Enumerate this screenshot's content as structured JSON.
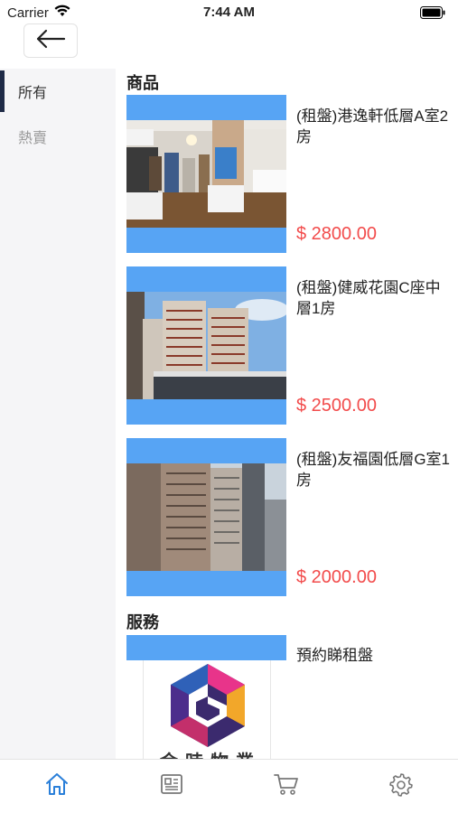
{
  "status_bar": {
    "carrier": "Carrier",
    "time": "7:44 AM"
  },
  "sidebar": {
    "items": [
      {
        "label": "所有",
        "active": true
      },
      {
        "label": "熱賣",
        "active": false
      }
    ]
  },
  "main": {
    "products_title": "商品",
    "products": [
      {
        "name": "(租盤)港逸軒低層A室2房",
        "price": "$ 2800.00"
      },
      {
        "name": "(租盤)健威花園C座中層1房",
        "price": "$ 2500.00"
      },
      {
        "name": "(租盤)友福園低層G室1房",
        "price": "$ 2000.00"
      }
    ],
    "services_title": "服務",
    "services": [
      {
        "name": "預約睇租盤",
        "logo_text": "金時物業"
      }
    ]
  },
  "tab_bar": {
    "tabs": [
      {
        "icon": "home-icon",
        "active": true
      },
      {
        "icon": "news-icon",
        "active": false
      },
      {
        "icon": "cart-icon",
        "active": false
      },
      {
        "icon": "gear-icon",
        "active": false
      }
    ]
  },
  "colors": {
    "accent": "#57a4f4",
    "price": "#f24b4b",
    "tab_active": "#2a7fd9",
    "sidebar_indicator": "#1f2b47"
  }
}
